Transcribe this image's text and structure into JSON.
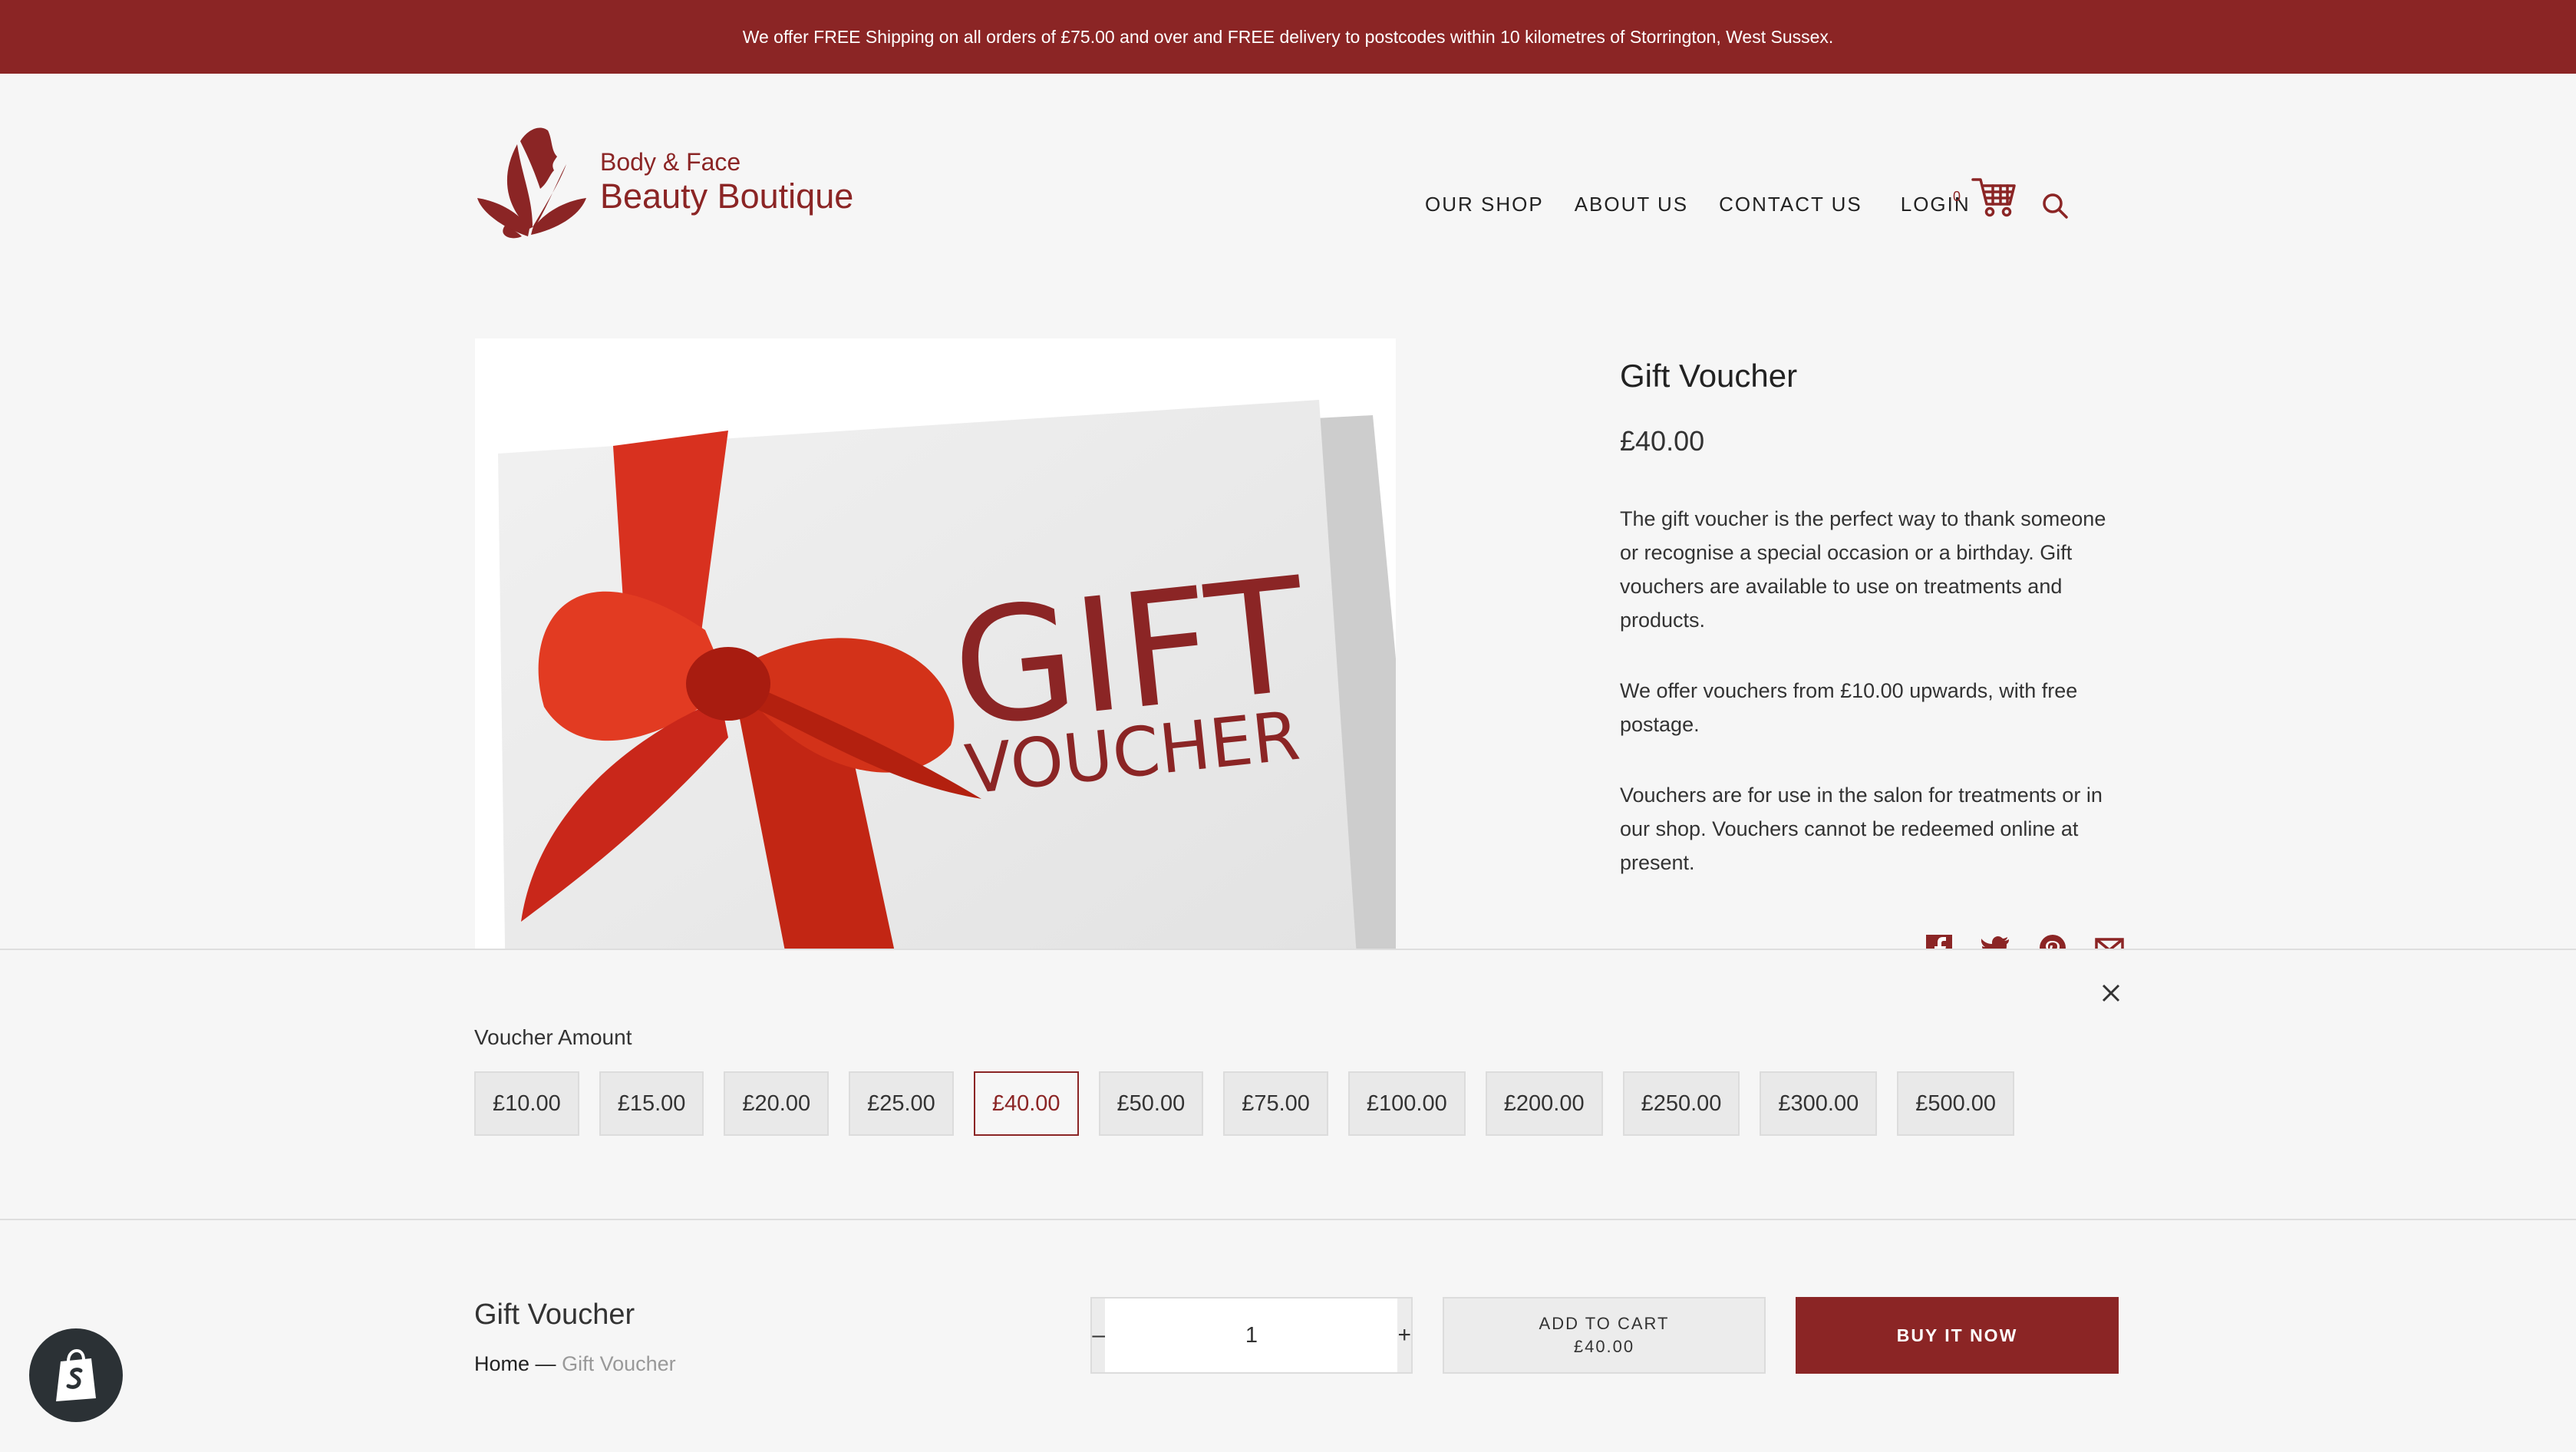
{
  "announcement": "We offer FREE Shipping on all orders of £75.00 and over and FREE delivery to postcodes within 10 kilometres of Storrington, West Sussex.",
  "logo": {
    "line1": "Body & Face",
    "line2": "Beauty Boutique"
  },
  "nav": {
    "shop": "OUR SHOP",
    "about": "ABOUT US",
    "contact": "CONTACT US",
    "login": "LOGIN",
    "cart_count": "0"
  },
  "image": {
    "line1": "GIFT",
    "line2": "VOUCHER"
  },
  "product": {
    "title": "Gift Voucher",
    "price": "£40.00",
    "description": [
      "The gift voucher is the perfect way to thank someone or recognise a special occasion or a birthday. Gift vouchers are available to use on treatments and products.",
      "We offer vouchers from £10.00 upwards, with free postage.",
      "Vouchers are for use in the salon for treatments or in our shop. Vouchers cannot be redeemed online at present."
    ]
  },
  "variant": {
    "label": "Voucher Amount",
    "options": [
      "£10.00",
      "£15.00",
      "£20.00",
      "£25.00",
      "£40.00",
      "£50.00",
      "£75.00",
      "£100.00",
      "£200.00",
      "£250.00",
      "£300.00",
      "£500.00"
    ],
    "selected": "£40.00"
  },
  "bottom": {
    "title": "Gift Voucher",
    "breadcrumb_home": "Home",
    "breadcrumb_sep": "—",
    "breadcrumb_current": "Gift Voucher",
    "qty_minus": "–",
    "qty_value": "1",
    "qty_plus": "+",
    "add_to_cart": "ADD TO CART",
    "add_to_cart_price": "£40.00",
    "buy_now": "BUY IT NOW"
  },
  "colors": {
    "brand": "#8b2525",
    "background": "#f6f6f6",
    "ribbon": "#d8311f"
  },
  "icons": {
    "cart": "cart-icon",
    "search": "search-icon",
    "close": "close-icon",
    "facebook": "facebook-icon",
    "twitter": "twitter-icon",
    "pinterest": "pinterest-icon",
    "email": "email-icon",
    "shopify": "shopify-bag-icon"
  }
}
